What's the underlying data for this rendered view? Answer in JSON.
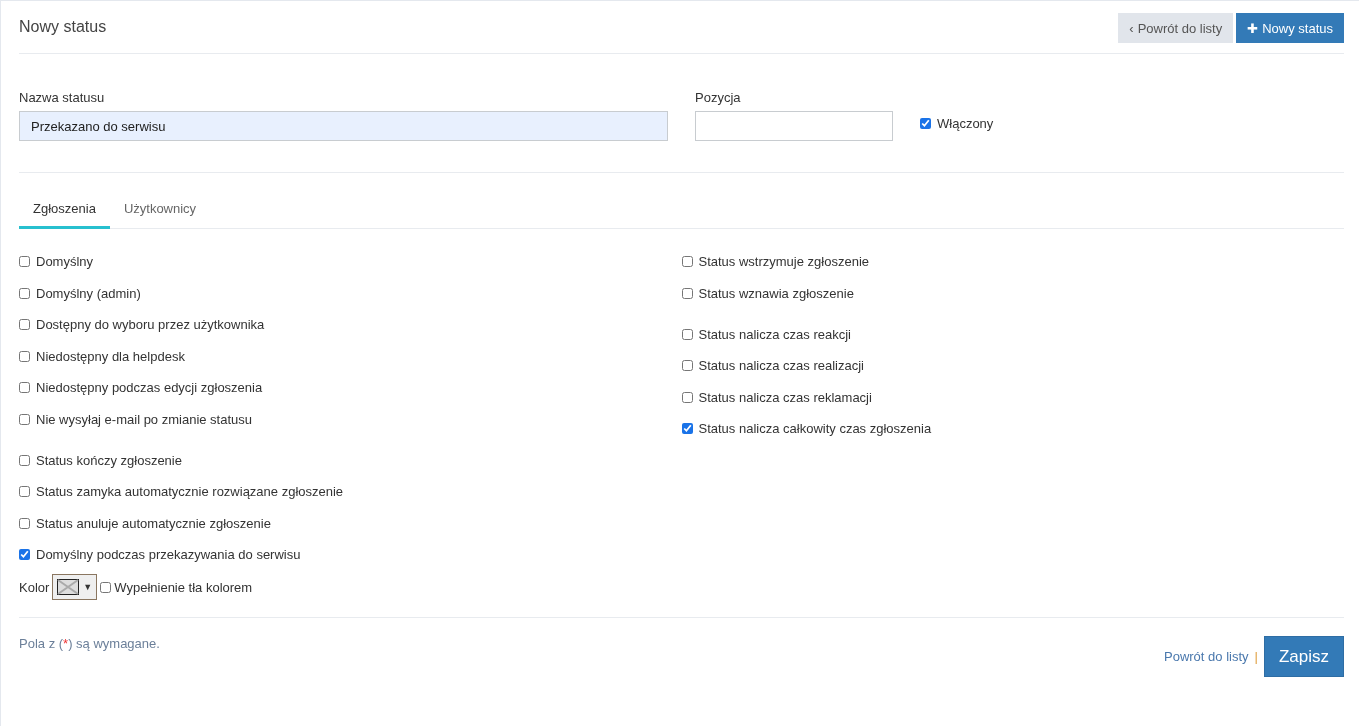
{
  "header": {
    "title": "Nowy status",
    "back_button": {
      "icon": "‹",
      "label": "Powrót do listy"
    },
    "new_button": {
      "icon": "✚",
      "label": "Nowy status"
    }
  },
  "form": {
    "name": {
      "label": "Nazwa statusu",
      "value": "Przekazano do serwisu"
    },
    "position": {
      "label": "Pozycja"
    },
    "enabled": {
      "label": "Włączony",
      "checked": true
    }
  },
  "tabs": [
    {
      "label": "Zgłoszenia",
      "selected": true
    },
    {
      "label": "Użytkownicy",
      "selected": false
    }
  ],
  "options_left": [
    [
      {
        "label": "Domyślny",
        "checked": false
      },
      {
        "label": "Domyślny (admin)",
        "checked": false
      },
      {
        "label": "Dostępny do wyboru przez użytkownika",
        "checked": false
      },
      {
        "label": "Niedostępny dla helpdesk",
        "checked": false
      },
      {
        "label": "Niedostępny podczas edycji zgłoszenia",
        "checked": false
      },
      {
        "label": "Nie wysyłaj e-mail po zmianie statusu",
        "checked": false
      }
    ],
    [
      {
        "label": "Status kończy zgłoszenie",
        "checked": false
      },
      {
        "label": "Status zamyka automatycznie rozwiązane zgłoszenie",
        "checked": false
      },
      {
        "label": "Status anuluje automatycznie zgłoszenie",
        "checked": false
      },
      {
        "label": "Domyślny podczas przekazywania do serwisu",
        "checked": true
      }
    ]
  ],
  "options_right": [
    [
      {
        "label": "Status wstrzymuje zgłoszenie",
        "checked": false
      },
      {
        "label": "Status wznawia zgłoszenie",
        "checked": false
      }
    ],
    [
      {
        "label": "Status nalicza czas reakcji",
        "checked": false
      },
      {
        "label": "Status nalicza czas realizacji",
        "checked": false
      },
      {
        "label": "Status nalicza czas reklamacji",
        "checked": false
      },
      {
        "label": "Status nalicza całkowity czas zgłoszenia",
        "checked": true
      }
    ]
  ],
  "color": {
    "label": "Kolor",
    "arrow": "▼",
    "fill": {
      "label": "Wypełnienie tła kolorem",
      "checked": false
    }
  },
  "footer": {
    "note": {
      "text_before": "Pola z (",
      "required_mark": "*",
      "text_after": ") są wymagane."
    },
    "back_link": "Powrót do listy",
    "separator": "|",
    "save_button": "Zapisz"
  }
}
